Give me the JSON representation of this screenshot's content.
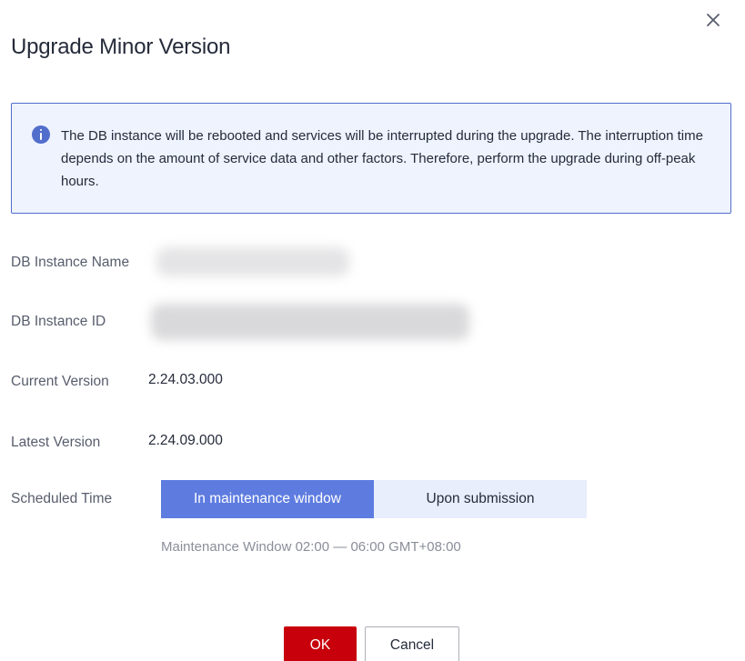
{
  "dialog": {
    "title": "Upgrade Minor Version",
    "close_icon": "close-icon"
  },
  "alert": {
    "icon": "info-icon",
    "message": "The DB instance will be rebooted and services will be interrupted during the upgrade. The interruption time depends on the amount of service data and other factors. Therefore, perform the upgrade during off-peak hours."
  },
  "fields": {
    "instance_name_label": "DB Instance Name",
    "instance_id_label": "DB Instance ID",
    "current_version_label": "Current Version",
    "current_version_value": "2.24.03.000",
    "latest_version_label": "Latest Version",
    "latest_version_value": "2.24.09.000",
    "scheduled_time_label": "Scheduled Time"
  },
  "scheduled_time": {
    "options": [
      "In maintenance window",
      "Upon submission"
    ],
    "selected": "In maintenance window",
    "hint": "Maintenance Window 02:00 — 06:00 GMT+08:00"
  },
  "footer": {
    "ok_label": "OK",
    "cancel_label": "Cancel"
  },
  "colors": {
    "primary": "#5e7ce0",
    "danger": "#c7000b",
    "alert_bg": "#eef3fe",
    "alert_border": "#526ecc"
  }
}
